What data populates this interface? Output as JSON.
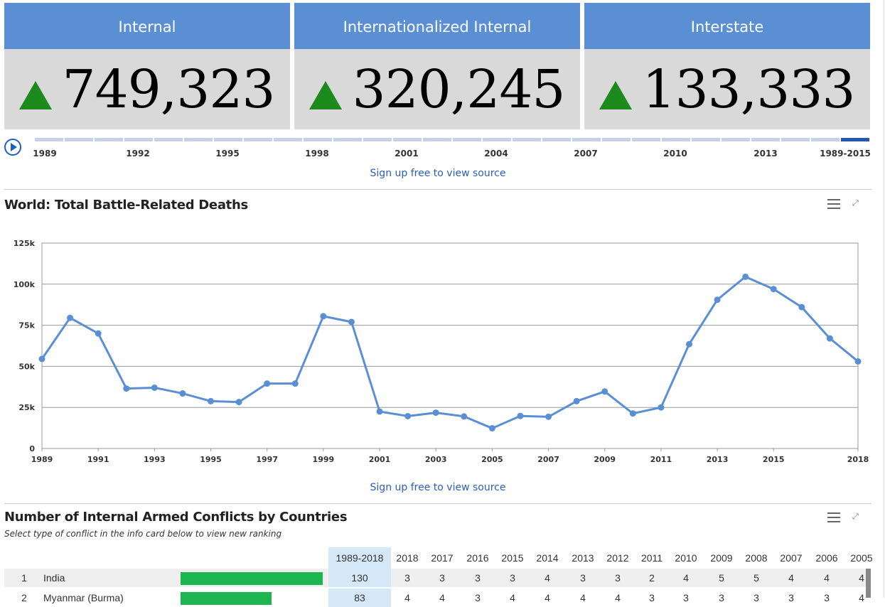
{
  "cards": [
    {
      "label": "Internal",
      "value": "749,323"
    },
    {
      "label": "Internationalized Internal",
      "value": "320,245"
    },
    {
      "label": "Interstate",
      "value": "133,333"
    }
  ],
  "timeline": {
    "labels": [
      "1989",
      "1992",
      "1995",
      "1998",
      "2001",
      "2004",
      "2007",
      "2010",
      "2013",
      "1989-2015"
    ],
    "source_link": "Sign up free to view source"
  },
  "chart_data": {
    "type": "line",
    "title": "World: Total Battle-Related Deaths",
    "xlabel": "",
    "ylabel": "",
    "ylim": [
      0,
      125000
    ],
    "yticks": [
      "0",
      "25k",
      "50k",
      "75k",
      "100k",
      "125k"
    ],
    "xticks": [
      "1989",
      "1991",
      "1993",
      "1995",
      "1997",
      "1999",
      "2001",
      "2003",
      "2005",
      "2007",
      "2009",
      "2011",
      "2013",
      "2015",
      "2018"
    ],
    "x": [
      1989,
      1990,
      1991,
      1992,
      1993,
      1994,
      1995,
      1996,
      1997,
      1998,
      1999,
      2000,
      2001,
      2002,
      2003,
      2004,
      2005,
      2006,
      2007,
      2008,
      2009,
      2010,
      2011,
      2012,
      2013,
      2014,
      2015,
      2016,
      2017,
      2018
    ],
    "values": [
      54500,
      79500,
      70000,
      36500,
      37000,
      33500,
      28800,
      28300,
      39500,
      39500,
      80500,
      77000,
      22500,
      19700,
      21800,
      19500,
      12300,
      19800,
      19300,
      28800,
      34700,
      21300,
      25000,
      63500,
      90500,
      104500,
      97000,
      86000,
      67000,
      53000
    ],
    "color": "#5b8fd3",
    "grid": true,
    "source_link": "Sign up free to view source"
  },
  "table": {
    "title": "Number of Internal Armed Conflicts by Countries",
    "subtitle": "Select type of conflict in the info card below to view new ranking",
    "columns": [
      "1989-2018",
      "2018",
      "2017",
      "2016",
      "2015",
      "2014",
      "2013",
      "2012",
      "2011",
      "2010",
      "2009",
      "2008",
      "2007",
      "2006",
      "2005"
    ],
    "rows": [
      {
        "rank": "1",
        "country": "India",
        "bar_fraction": 1.0,
        "values": [
          "130",
          "3",
          "3",
          "3",
          "3",
          "4",
          "3",
          "3",
          "2",
          "4",
          "5",
          "5",
          "4",
          "4",
          "4"
        ]
      },
      {
        "rank": "2",
        "country": "Myanmar (Burma)",
        "bar_fraction": 0.64,
        "values": [
          "83",
          "4",
          "4",
          "3",
          "4",
          "4",
          "4",
          "4",
          "3",
          "3",
          "3",
          "3",
          "3",
          "3",
          "4"
        ]
      }
    ]
  },
  "colors": {
    "header_blue": "#5b8fd3",
    "up_green": "#1d8a1d",
    "bar_green": "#1db54f",
    "link_blue": "#2b5fb5"
  },
  "icons": {
    "play": "play-circle-icon",
    "menu": "hamburger-menu-icon",
    "expand": "expand-icon",
    "up": "up-triangle-icon"
  }
}
